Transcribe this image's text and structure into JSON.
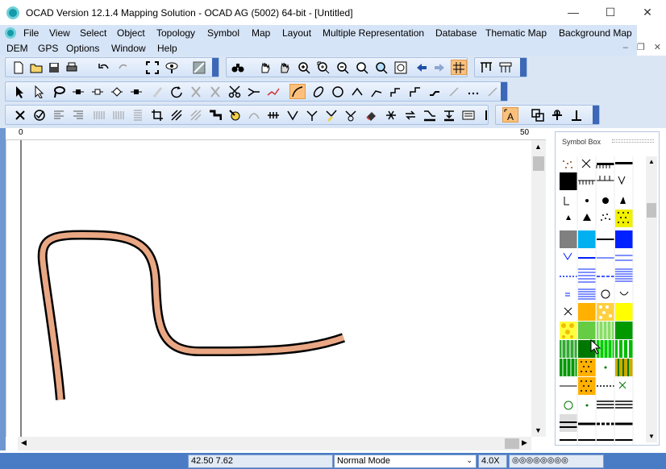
{
  "window": {
    "title": "OCAD Version 12.1.4  Mapping Solution - OCAD AG (5002) 64-bit - [Untitled]"
  },
  "menu": {
    "row1": [
      "File",
      "View",
      "Select",
      "Object",
      "Topology",
      "Symbol",
      "Map",
      "Layout",
      "Multiple Representation",
      "Database",
      "Thematic Map",
      "Background Map"
    ],
    "row2": [
      "DEM",
      "GPS",
      "Options",
      "Window",
      "Help"
    ]
  },
  "ruler": {
    "start": "0",
    "end": "50"
  },
  "symbol_box": {
    "title": "Symbol Box"
  },
  "status": {
    "coords": "42.50   7.62",
    "mode": "Normal Mode",
    "zoom": "4.0X"
  },
  "colors": {
    "line_fill": "#e9a784",
    "line_edge": "#000000",
    "active_tool": "#fcc07c",
    "statusbar": "#4a7cc6"
  }
}
